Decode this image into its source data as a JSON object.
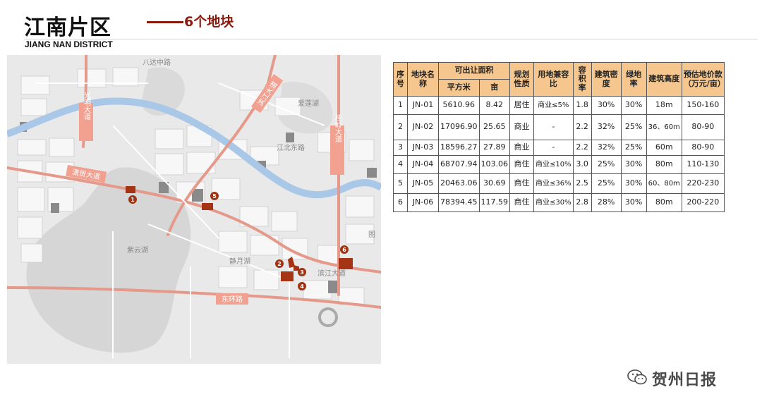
{
  "header": {
    "title": "江南片区",
    "subtitle": "6个地块",
    "english": "JIANG NAN DISTRICT"
  },
  "map": {
    "roads": [
      "光明大道",
      "滨江大道",
      "桂岭大道",
      "潇贺大道",
      "东环路"
    ],
    "places": [
      "八达中路",
      "爱莲湖",
      "紫云湖",
      "静月湖",
      "江北东路",
      "滨江大道",
      "图"
    ],
    "markers": [
      "1",
      "2",
      "3",
      "4",
      "5",
      "6"
    ],
    "colors": {
      "river": "#a9c7e6",
      "parcel": "#a43414",
      "marker": "#9e3413",
      "road": "#e5998a",
      "label": "#f2a08f"
    }
  },
  "table": {
    "headers": {
      "seq": "序号",
      "name": "地块名称",
      "area": "可出让面积",
      "area_sqm": "平方米",
      "area_mu": "亩",
      "usage": "规划性质",
      "mixed": "用地兼容比",
      "far": "容积率",
      "density": "建筑密度",
      "green": "绿地率",
      "height": "建筑高度",
      "price": "预估地价款（万元/亩）"
    },
    "rows": [
      {
        "seq": "1",
        "name": "JN-01",
        "sqm": "5610.96",
        "mu": "8.42",
        "usage": "居住",
        "mixed": "商业≤5%",
        "far": "1.8",
        "density": "30%",
        "green": "30%",
        "height": "18m",
        "price": "150-160"
      },
      {
        "seq": "2",
        "name": "JN-02",
        "sqm": "17096.90",
        "mu": "25.65",
        "usage": "商业",
        "mixed": "-",
        "far": "2.2",
        "density": "32%",
        "green": "25%",
        "height": "36、60m",
        "price": "80-90"
      },
      {
        "seq": "3",
        "name": "JN-03",
        "sqm": "18596.27",
        "mu": "27.89",
        "usage": "商业",
        "mixed": "-",
        "far": "2.2",
        "density": "32%",
        "green": "25%",
        "height": "60m",
        "price": "80-90"
      },
      {
        "seq": "4",
        "name": "JN-04",
        "sqm": "68707.94",
        "mu": "103.06",
        "usage": "商住",
        "mixed": "商业≤10%",
        "far": "3.0",
        "density": "25%",
        "green": "30%",
        "height": "80m",
        "price": "110-130"
      },
      {
        "seq": "5",
        "name": "JN-05",
        "sqm": "20463.06",
        "mu": "30.69",
        "usage": "商住",
        "mixed": "商业≤36%",
        "far": "2.5",
        "density": "25%",
        "green": "30%",
        "height": "60、80m",
        "price": "220-230"
      },
      {
        "seq": "6",
        "name": "JN-06",
        "sqm": "78394.45",
        "mu": "117.59",
        "usage": "商住",
        "mixed": "商业≤30%",
        "far": "2.8",
        "density": "28%",
        "green": "30%",
        "height": "80m",
        "price": "200-220"
      }
    ]
  },
  "watermark": {
    "text": "贺州日报",
    "icon": "wechat-icon"
  }
}
